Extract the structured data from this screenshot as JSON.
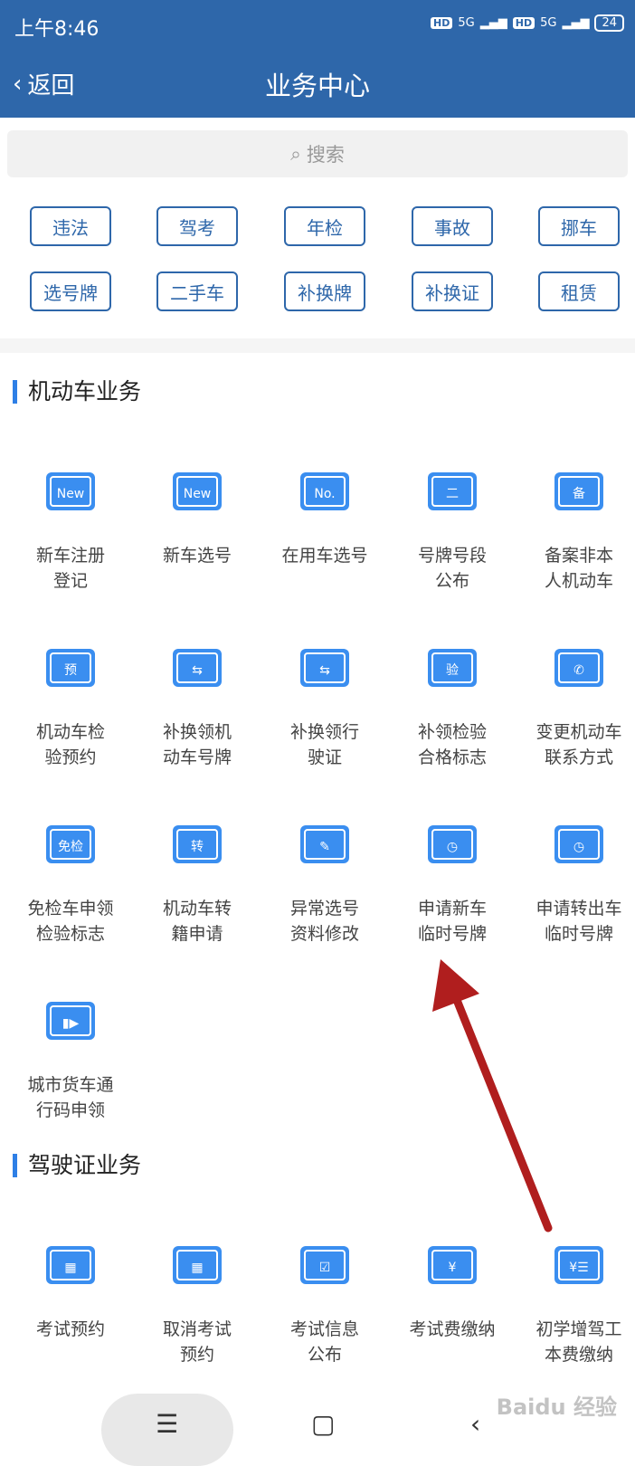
{
  "status": {
    "time": "上午8:46",
    "network1": "5G",
    "network2": "5G",
    "hd": "HD",
    "battery": "24"
  },
  "header": {
    "back": "返回",
    "title": "业务中心"
  },
  "search": {
    "placeholder": "搜索"
  },
  "tags": [
    "违法",
    "驾考",
    "年检",
    "事故",
    "挪车",
    "选号牌",
    "二手车",
    "补换牌",
    "补换证",
    "租赁"
  ],
  "sections": [
    {
      "title": "机动车业务",
      "items": [
        {
          "label1": "新车注册",
          "label2": "登记",
          "icon": "plate-new-check-icon",
          "glyph": "New"
        },
        {
          "label1": "新车选号",
          "label2": "",
          "icon": "plate-new-icon",
          "glyph": "New"
        },
        {
          "label1": "在用车选号",
          "label2": "",
          "icon": "plate-no-icon",
          "glyph": "No."
        },
        {
          "label1": "号牌号段",
          "label2": "公布",
          "icon": "hanging-sign-icon",
          "glyph": "二"
        },
        {
          "label1": "备案非本",
          "label2": "人机动车",
          "icon": "shield-icon",
          "glyph": "备"
        },
        {
          "label1": "机动车检",
          "label2": "验预约",
          "icon": "truck-booking-icon",
          "glyph": "预"
        },
        {
          "label1": "补换领机",
          "label2": "动车号牌",
          "icon": "plate-swap-icon",
          "glyph": "⇆"
        },
        {
          "label1": "补换领行",
          "label2": "驶证",
          "icon": "license-swap-icon",
          "glyph": "⇆"
        },
        {
          "label1": "补领检验",
          "label2": "合格标志",
          "icon": "inspection-badge-icon",
          "glyph": "验"
        },
        {
          "label1": "变更机动车",
          "label2": "联系方式",
          "icon": "truck-phone-icon",
          "glyph": "✆"
        },
        {
          "label1": "免检车申领",
          "label2": "检验标志",
          "icon": "exempt-badge-icon",
          "glyph": "免检"
        },
        {
          "label1": "机动车转",
          "label2": "籍申请",
          "icon": "truck-transfer-icon",
          "glyph": "转"
        },
        {
          "label1": "异常选号",
          "label2": "资料修改",
          "icon": "plate-edit-icon",
          "glyph": "✎"
        },
        {
          "label1": "申请新车",
          "label2": "临时号牌",
          "icon": "plate-clock-icon",
          "glyph": "◷"
        },
        {
          "label1": "申请转出车",
          "label2": "临时号牌",
          "icon": "plate-clock-out-icon",
          "glyph": "◷"
        },
        {
          "label1": "城市货车通",
          "label2": "行码申领",
          "icon": "truck-pass-icon",
          "glyph": "▮▶"
        }
      ]
    },
    {
      "title": "驾驶证业务",
      "items": [
        {
          "label1": "考试预约",
          "label2": "",
          "icon": "calendar-icon",
          "glyph": "▦"
        },
        {
          "label1": "取消考试",
          "label2": "预约",
          "icon": "calendar-cancel-icon",
          "glyph": "▦"
        },
        {
          "label1": "考试信息",
          "label2": "公布",
          "icon": "exam-info-icon",
          "glyph": "☑"
        },
        {
          "label1": "考试费缴纳",
          "label2": "",
          "icon": "receipt-icon",
          "glyph": "¥"
        },
        {
          "label1": "初学增驾工",
          "label2": "本费缴纳",
          "icon": "payment-icon",
          "glyph": "¥☰"
        }
      ]
    }
  ],
  "watermark": "Baidu 经验",
  "colors": {
    "header": "#2e67aa",
    "icon": "#3a8ef0",
    "arrow": "#b01e1e"
  }
}
